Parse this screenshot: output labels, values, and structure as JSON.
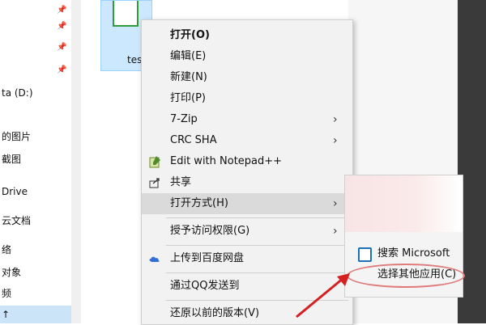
{
  "nav": {
    "items": [
      {
        "label": "",
        "pinned": true
      },
      {
        "label": "",
        "pinned": true
      },
      {
        "label": "",
        "pinned": true
      },
      {
        "label": "",
        "pinned": true
      },
      {
        "label": "ta (D:)"
      },
      {
        "label": "的图片"
      },
      {
        "label": "截图"
      },
      {
        "label": "Drive"
      },
      {
        "label": "云文档"
      },
      {
        "label": "络"
      },
      {
        "label": "对象"
      },
      {
        "label": "频"
      },
      {
        "label": "↑"
      }
    ]
  },
  "file": {
    "name": "tes"
  },
  "context_menu": {
    "items": {
      "open": "打开(O)",
      "edit": "编辑(E)",
      "new": "新建(N)",
      "print": "打印(P)",
      "zip": "7-Zip",
      "crc": "CRC SHA",
      "notepad": "Edit with Notepad++",
      "share": "共享",
      "open_with": "打开方式(H)",
      "grant_access": "授予访问权限(G)",
      "baidu": "上传到百度网盘",
      "qq": "通过QQ发送到",
      "restore": "还原以前的版本(V)"
    },
    "arrow": "›"
  },
  "submenu": {
    "store": "搜索 Microsoft",
    "choose_other": "选择其他应用(C)"
  },
  "colors": {
    "menu_bg": "#f2f2f2",
    "hover_bg": "#dadada",
    "selection": "#cce8ff",
    "annotation_red": "#d42020"
  }
}
